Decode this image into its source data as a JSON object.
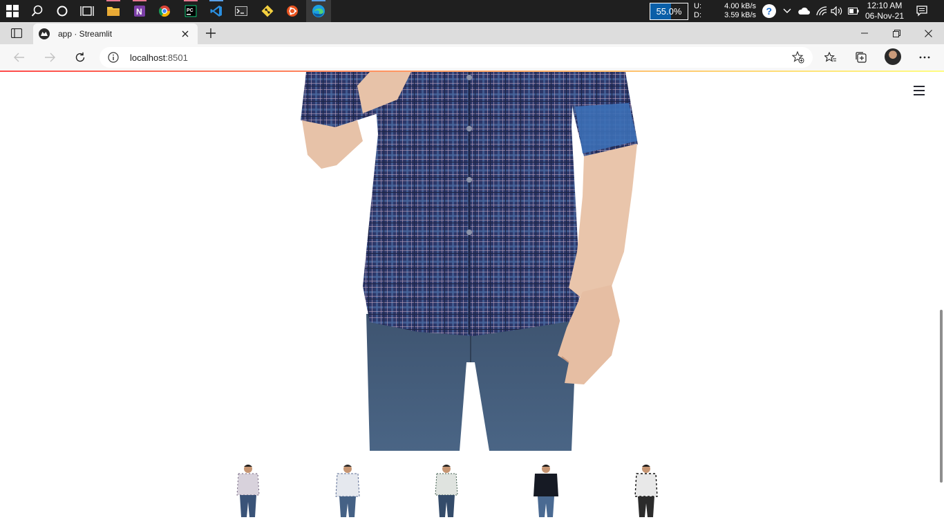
{
  "taskbar": {
    "icons": [
      "windows-start-icon",
      "search-icon",
      "cortana-icon",
      "task-view-icon",
      "file-explorer-icon",
      "onenote-icon",
      "chrome-icon",
      "pycharm-icon",
      "vscode-icon",
      "terminal-icon",
      "git-icon",
      "ubuntu-icon",
      "edge-icon"
    ],
    "battery_percent": "55.0%",
    "battery_level": 0.55,
    "net_upload_label": "U:",
    "net_upload": "4.00 kB/s",
    "net_download_label": "D:",
    "net_download": "3.59 kB/s",
    "time": "12:10 AM",
    "date": "06-Nov-21"
  },
  "browser": {
    "tab_title": "app · Streamlit",
    "url_host": "localhost",
    "url_port": ":8501"
  },
  "gallery": {
    "main_image": "plaid-shirt-model-closeup",
    "thumbnails": [
      "checked-shirt-1",
      "checked-shirt-2",
      "checked-shirt-3",
      "black-shirt-4",
      "checked-shirt-5"
    ]
  },
  "colors": {
    "decoration_start": "#ff4b4b",
    "decoration_end": "#fffd80"
  }
}
